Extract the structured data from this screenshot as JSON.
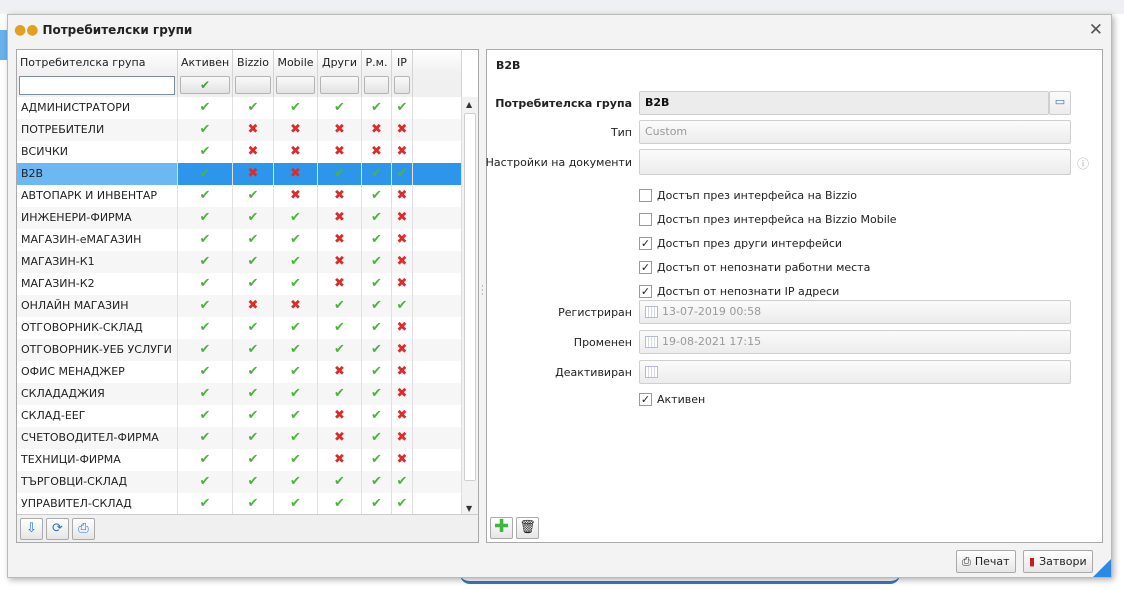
{
  "window": {
    "title": "Потребителски групи",
    "icon": "users-group-icon",
    "close_icon": "close-icon"
  },
  "grid": {
    "columns": [
      "Потребителска група",
      "Активен",
      "Bizzio",
      "Mobile",
      "Други",
      "Р.м.",
      "IP"
    ],
    "filter": {
      "name_value": "",
      "active_filter": "✔"
    },
    "selected": "B2B",
    "rows": [
      {
        "name": "АДМИНИСТРАТОРИ",
        "flags": [
          1,
          1,
          1,
          1,
          1,
          1
        ]
      },
      {
        "name": "ПОТРЕБИТЕЛИ",
        "flags": [
          1,
          0,
          0,
          0,
          0,
          0
        ]
      },
      {
        "name": "ВСИЧКИ",
        "flags": [
          1,
          0,
          0,
          0,
          0,
          0
        ]
      },
      {
        "name": "B2B",
        "flags": [
          1,
          0,
          0,
          1,
          1,
          1
        ]
      },
      {
        "name": "АВТОПАРК И ИНВЕНТАР",
        "flags": [
          1,
          1,
          0,
          0,
          1,
          0
        ]
      },
      {
        "name": "ИНЖЕНЕРИ-ФИРМА",
        "flags": [
          1,
          1,
          1,
          0,
          1,
          0
        ]
      },
      {
        "name": "МАГАЗИН-еМАГАЗИН",
        "flags": [
          1,
          1,
          1,
          0,
          1,
          0
        ]
      },
      {
        "name": "МАГАЗИН-К1",
        "flags": [
          1,
          1,
          1,
          0,
          1,
          0
        ]
      },
      {
        "name": "МАГАЗИН-К2",
        "flags": [
          1,
          1,
          1,
          0,
          1,
          0
        ]
      },
      {
        "name": "ОНЛАЙН МАГАЗИН",
        "flags": [
          1,
          0,
          0,
          1,
          1,
          1
        ]
      },
      {
        "name": "ОТГОВОРНИК-СКЛАД",
        "flags": [
          1,
          1,
          1,
          1,
          1,
          0
        ]
      },
      {
        "name": "ОТГОВОРНИК-УЕБ УСЛУГИ",
        "flags": [
          1,
          1,
          1,
          1,
          1,
          0
        ]
      },
      {
        "name": "ОФИС МЕНАДЖЕР",
        "flags": [
          1,
          1,
          1,
          0,
          1,
          0
        ]
      },
      {
        "name": "СКЛАДАДЖИЯ",
        "flags": [
          1,
          1,
          1,
          1,
          1,
          0
        ]
      },
      {
        "name": "СКЛАД-ЕЕГ",
        "flags": [
          1,
          1,
          1,
          0,
          1,
          0
        ]
      },
      {
        "name": "СЧЕТОВОДИТЕЛ-ФИРМА",
        "flags": [
          1,
          1,
          1,
          0,
          1,
          0
        ]
      },
      {
        "name": "ТЕХНИЦИ-ФИРМА",
        "flags": [
          1,
          1,
          1,
          0,
          1,
          0
        ]
      },
      {
        "name": "ТЪРГОВЦИ-СКЛАД",
        "flags": [
          1,
          1,
          1,
          1,
          1,
          1
        ]
      },
      {
        "name": "УПРАВИТЕЛ-СКЛАД",
        "flags": [
          1,
          1,
          1,
          1,
          1,
          1
        ]
      }
    ],
    "toolbar": [
      {
        "icon": "download-icon",
        "glyph": "⇩"
      },
      {
        "icon": "refresh-icon",
        "glyph": "⟳"
      },
      {
        "icon": "print-icon",
        "glyph": "⎙"
      }
    ]
  },
  "detail": {
    "title": "B2B",
    "group_label": "Потребителска група",
    "group_value": "B2B",
    "type_label": "Тип",
    "type_value": "Custom",
    "doc_settings_label": "Настройки на документи",
    "doc_settings_value": "",
    "checkboxes": [
      {
        "label": "Достъп през интерфейса на Bizzio",
        "checked": false
      },
      {
        "label": "Достъп през интерфейса на Bizzio Mobile",
        "checked": false
      },
      {
        "label": "Достъп през други интерфейси",
        "checked": true
      },
      {
        "label": "Достъп от непознати работни места",
        "checked": true
      },
      {
        "label": "Достъп от непознати IP адреси",
        "checked": true
      }
    ],
    "registered_label": "Регистриран",
    "registered_value": "13-07-2019 00:58",
    "changed_label": "Променен",
    "changed_value": "19-08-2021 17:15",
    "deactivated_label": "Деактивиран",
    "deactivated_value": "",
    "active_label": "Активен",
    "active_checked": true
  },
  "footer": {
    "print_label": "Печат",
    "close_label": "Затвори"
  },
  "colors": {
    "selection": "#2e96ea",
    "check": "#4bb43c",
    "cross": "#e02a2a"
  }
}
